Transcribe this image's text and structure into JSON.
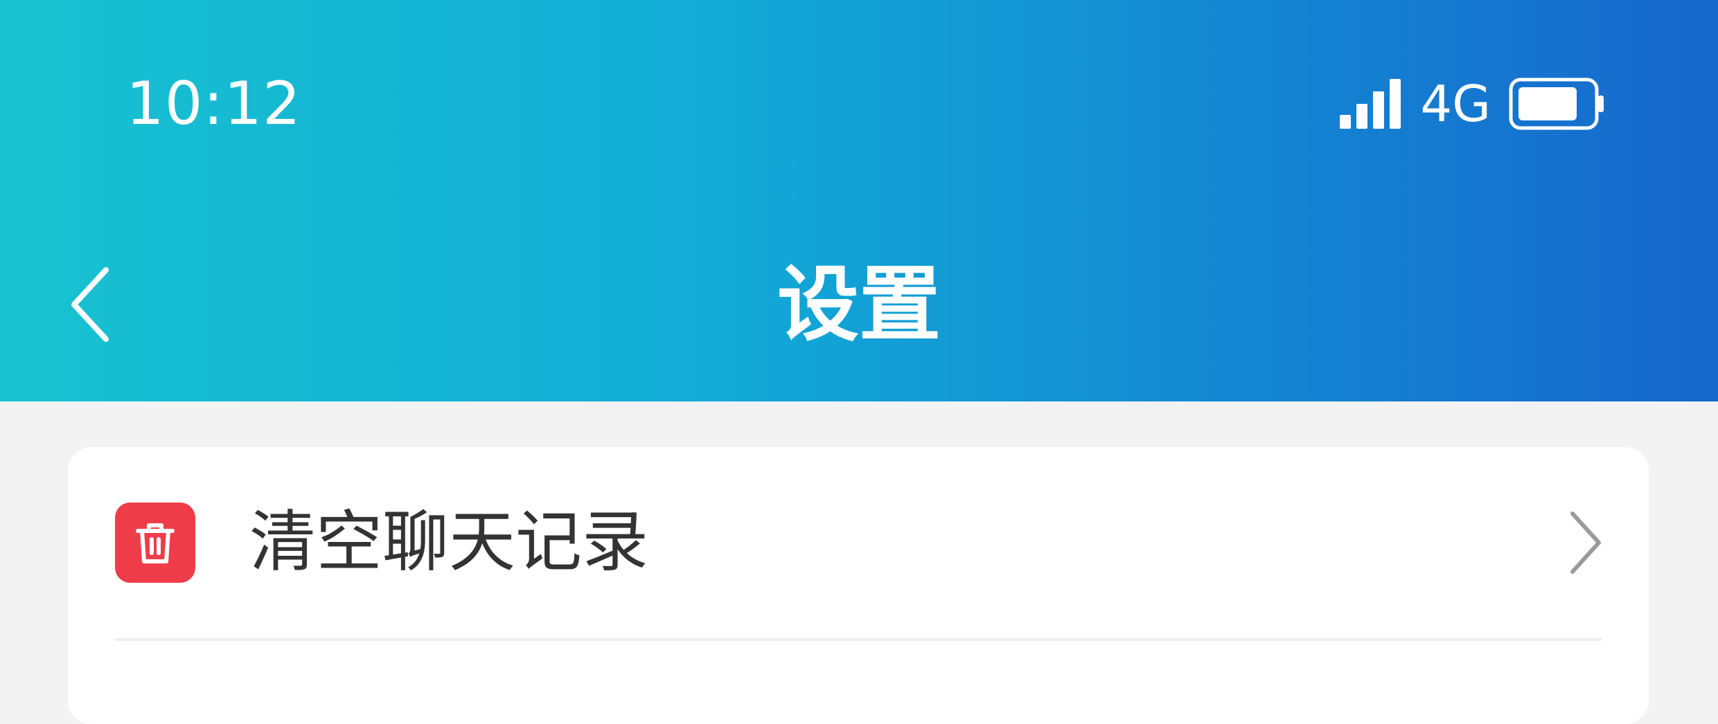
{
  "status_bar": {
    "time": "10:12",
    "network": "4G",
    "signal_icon": "signal-bars-icon",
    "battery_icon": "battery-icon"
  },
  "nav": {
    "title": "设置",
    "back_icon": "chevron-left-icon"
  },
  "settings": {
    "items": [
      {
        "label": "清空聊天记录",
        "icon": "trash-icon",
        "icon_color": "#ee3d49"
      }
    ]
  },
  "colors": {
    "header_gradient_start": "#18c2d0",
    "header_gradient_end": "#1667cc",
    "background": "#f3f3f3"
  }
}
